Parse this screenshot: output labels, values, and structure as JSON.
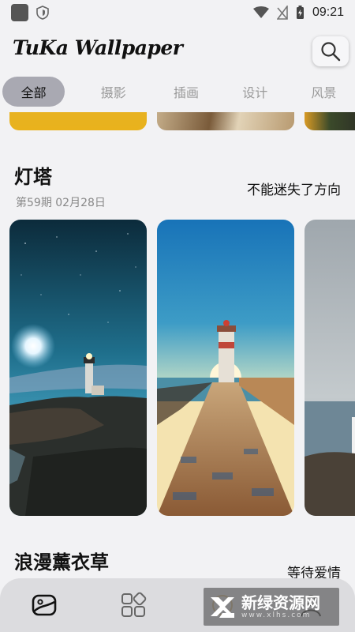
{
  "status_bar": {
    "time": "09:21"
  },
  "header": {
    "app_title": "TuKa Wallpaper"
  },
  "tabs": [
    {
      "label": "全部",
      "active": true
    },
    {
      "label": "摄影",
      "active": false
    },
    {
      "label": "插画",
      "active": false
    },
    {
      "label": "设计",
      "active": false
    },
    {
      "label": "风景",
      "active": false
    }
  ],
  "sections": [
    {
      "title": "灯塔",
      "issue": "第59期  02月28日",
      "tagline": "不能迷失了方向"
    },
    {
      "title": "浪漫薰衣草",
      "tagline": "等待爱情"
    }
  ],
  "bottom_nav": {
    "items": [
      "home-icon",
      "category-grid-icon",
      "discover-icon",
      "profile-icon"
    ]
  },
  "watermark": {
    "title": "新绿资源网",
    "subtitle": "www.xlhs.com"
  },
  "colors": {
    "background": "#f2f2f4",
    "tab_active": "#a9a9b2",
    "bottom_nav": "#dcdcdf"
  }
}
